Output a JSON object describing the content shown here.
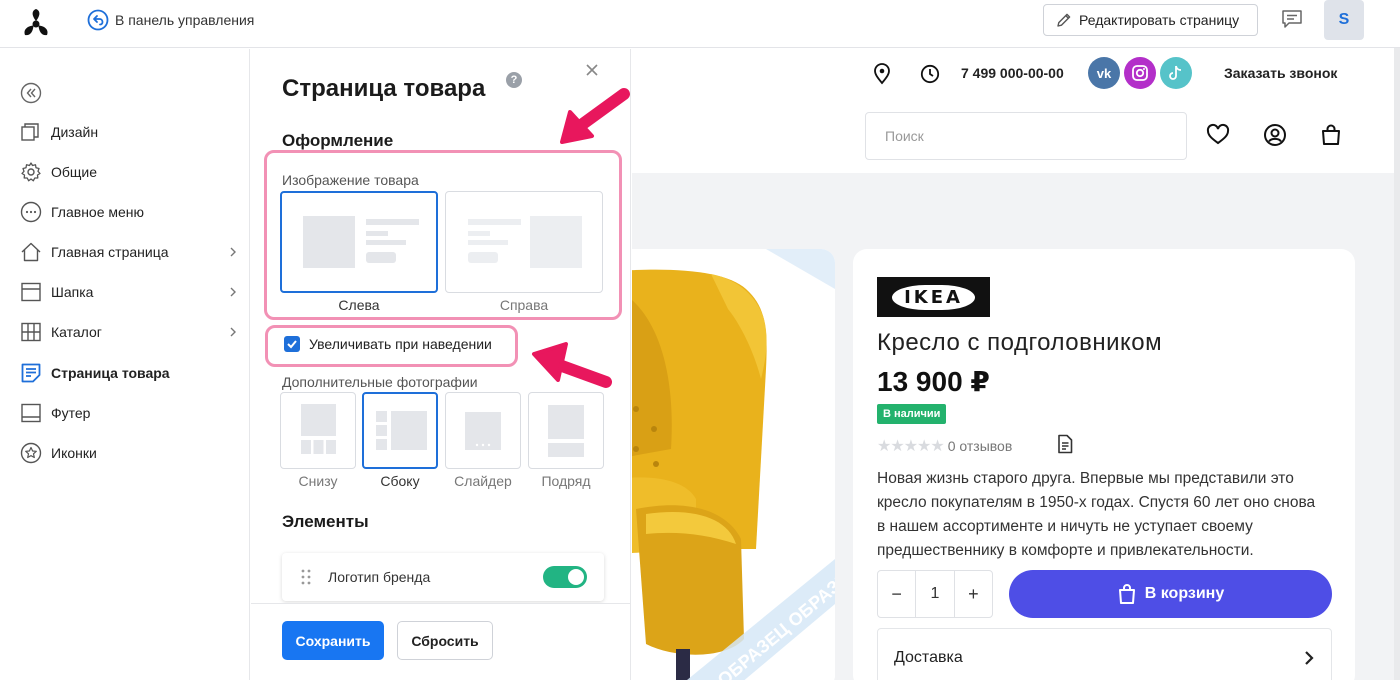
{
  "topbar": {
    "back_label": "В панель управления",
    "edit_page_label": "Редактировать страницу",
    "avatar_letter": "S"
  },
  "sidebar": {
    "items": [
      {
        "label": "Дизайн",
        "icon": "layers-icon"
      },
      {
        "label": "Общие",
        "icon": "gear-icon"
      },
      {
        "label": "Главное меню",
        "icon": "dots-circle-icon"
      },
      {
        "label": "Главная страница",
        "icon": "home-icon",
        "has_submenu": true
      },
      {
        "label": "Шапка",
        "icon": "header-icon",
        "has_submenu": true
      },
      {
        "label": "Каталог",
        "icon": "grid-icon",
        "has_submenu": true
      },
      {
        "label": "Страница товара",
        "icon": "product-page-icon",
        "active": true
      },
      {
        "label": "Футер",
        "icon": "footer-icon"
      },
      {
        "label": "Иконки",
        "icon": "star-circle-icon"
      }
    ]
  },
  "panel": {
    "title": "Страница товара",
    "design_heading": "Оформление",
    "image_label": "Изображение товара",
    "image_options": [
      {
        "label": "Слева",
        "selected": true
      },
      {
        "label": "Справа",
        "selected": false
      }
    ],
    "zoom_checkbox_label": "Увеличивать при наведении",
    "zoom_checked": true,
    "extra_photos_label": "Дополнительные фотографии",
    "extra_photo_options": [
      {
        "label": "Снизу",
        "selected": false
      },
      {
        "label": "Сбоку",
        "selected": true
      },
      {
        "label": "Слайдер",
        "selected": false
      },
      {
        "label": "Подряд",
        "selected": false
      }
    ],
    "elements_heading": "Элементы",
    "elements": [
      {
        "label": "Логотип бренда",
        "enabled": true
      }
    ],
    "save_label": "Сохранить",
    "reset_label": "Сбросить"
  },
  "store": {
    "phone": "7 499 000-00-00",
    "social": [
      "VK",
      "Instagram",
      "TikTok"
    ],
    "callback_label": "Заказать звонок",
    "search_placeholder": "Поиск",
    "product": {
      "brand": "IKEA",
      "watermark": "ОБРАЗЕЦ ОБРАЗЕЦ",
      "title": "Кресло с подголовником",
      "price": "13 900 ₽",
      "stock": "В наличии",
      "reviews": "0 отзывов",
      "description": "Новая жизнь старого друга. Впервые мы представили это кресло покупателям в 1950-х годах. Спустя 60 лет оно снова в нашем ассортименте и ничуть не уступает своему предшественнику в комфорте и привлекательности.",
      "quantity": "1",
      "qty_minus": "−",
      "qty_plus": "+",
      "cart_label": "В корзину",
      "delivery_label": "Доставка"
    }
  },
  "colors": {
    "accent_blue": "#1e6fd9",
    "save_blue": "#1876f2",
    "cart_purple": "#4e4ee6",
    "toggle_green": "#22b483",
    "stock_green": "#23b26d",
    "highlight_pink": "#f291b5",
    "arrow_red": "#e8175d",
    "chair_yellow": "#e9b21c"
  }
}
